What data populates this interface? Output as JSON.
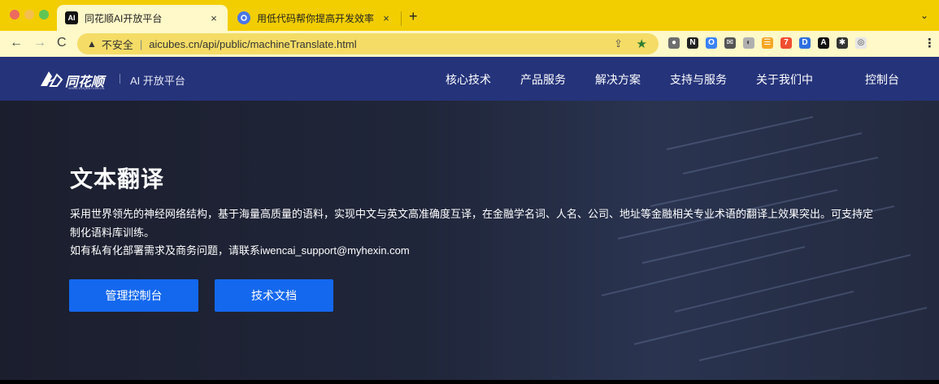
{
  "browser": {
    "tabs": [
      {
        "favicon": "AI",
        "title": "同花顺AI开放平台",
        "close": "×"
      },
      {
        "favicon": "",
        "title": "用低代码帮你提高开发效率 - 卡",
        "close": "×"
      }
    ],
    "new_tab": "+",
    "tab_menu": "⌄",
    "nav": {
      "back": "←",
      "forward": "→",
      "reload": "C"
    },
    "omnibox": {
      "security_icon": "▲",
      "security_text": "不安全",
      "separator": "|",
      "url": "aicubes.cn/api/public/machineTranslate.html"
    },
    "share_icon": "⇪",
    "star_icon": "★",
    "extensions": [
      {
        "name": "ext-1",
        "color": "#6e6e6e",
        "glyph": "●"
      },
      {
        "name": "ext-2",
        "color": "#222222",
        "glyph": "N"
      },
      {
        "name": "ext-3",
        "color": "#3b82f6",
        "glyph": "O"
      },
      {
        "name": "ext-4",
        "color": "#555555",
        "glyph": "✉"
      },
      {
        "name": "ext-5",
        "color": "#b0b0b0",
        "glyph": "◐"
      },
      {
        "name": "ext-6",
        "color": "#f5a623",
        "glyph": "☰"
      },
      {
        "name": "ext-7",
        "color": "#f04e30",
        "glyph": "7"
      },
      {
        "name": "ext-8",
        "color": "#2f6fe0",
        "glyph": "D"
      },
      {
        "name": "ext-9",
        "color": "#111111",
        "glyph": "A"
      },
      {
        "name": "ext-10",
        "color": "#333333",
        "glyph": "✱"
      },
      {
        "name": "ext-11",
        "color": "#e6e6e6",
        "glyph": "◎"
      }
    ],
    "menu": "⋮"
  },
  "site": {
    "logo_text": "同花顺",
    "logo_sub": "WWW.10JQKA.COM.CN",
    "platform": "AI 开放平台",
    "menu": [
      {
        "label": "核心技术"
      },
      {
        "label": "产品服务"
      },
      {
        "label": "解决方案"
      },
      {
        "label": "支持与服务"
      },
      {
        "label": "关于我们中"
      },
      {
        "label": "控制台"
      }
    ]
  },
  "hero": {
    "title": "文本翻译",
    "description": "采用世界领先的神经网络结构，基于海量高质量的语料，实现中文与英文高准确度互译，在金融学名词、人名、公司、地址等金融相关专业术语的翻译上效果突出。可支持定制化语料库训练。",
    "contact": "如有私有化部署需求及商务问题，请联系iwencai_support@myhexin.com",
    "buttons": {
      "console": "管理控制台",
      "docs": "技术文档"
    }
  },
  "colors": {
    "tabstrip": "#f2ce00",
    "nav_bg": "#25337a",
    "hero_bg": "#1f2335",
    "primary": "#1468ee"
  }
}
